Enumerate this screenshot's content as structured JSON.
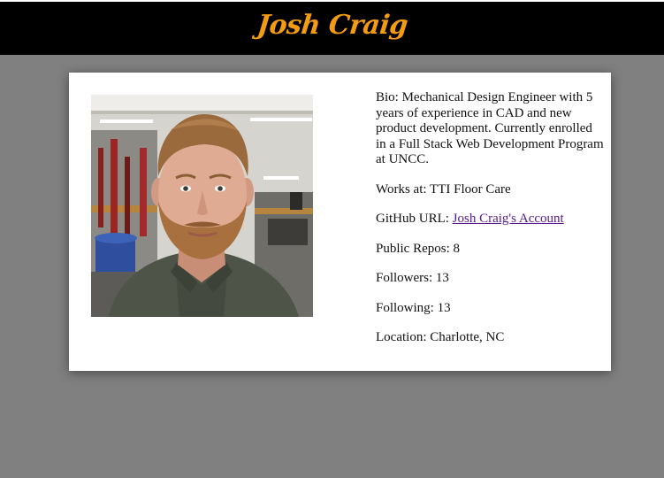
{
  "header": {
    "title": "Josh Craig"
  },
  "profile": {
    "bio_label": "Bio:",
    "bio_text": "Mechanical Design Engineer with 5 years of experience in CAD and new product development. Currently enrolled in a Full Stack Web Development Program at UNCC.",
    "works_label": "Works at:",
    "works_value": "TTI Floor Care",
    "github_label": "GitHub URL:",
    "github_link_text": "Josh Craig's Account",
    "repos_label": "Public Repos:",
    "repos_value": "8",
    "followers_label": "Followers:",
    "followers_value": "13",
    "following_label": "Following:",
    "following_value": "13",
    "location_label": "Location:",
    "location_value": "Charlotte, NC"
  },
  "colors": {
    "page_background": "#808080",
    "header_background": "#000000",
    "title_color": "#f39c12",
    "link_color": "#551a8b"
  }
}
